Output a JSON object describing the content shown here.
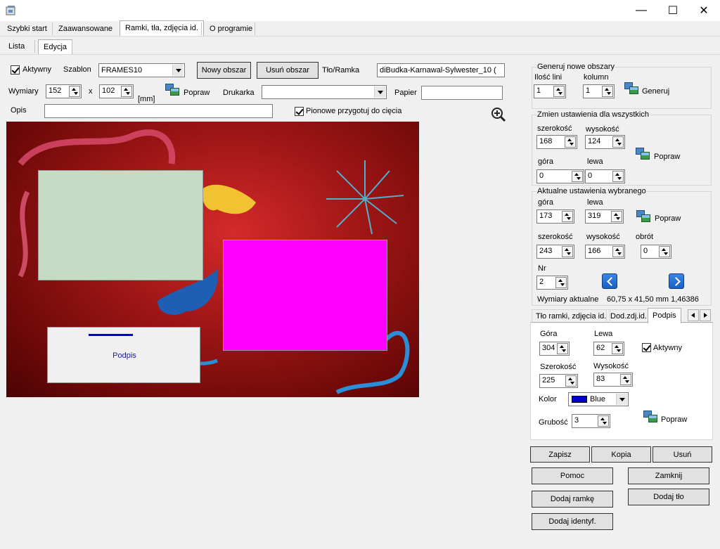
{
  "window": {
    "minimize": "—",
    "maximize": "☐",
    "close": "✕"
  },
  "main_tabs": [
    {
      "label": "Szybki start"
    },
    {
      "label": "Zaawansowane"
    },
    {
      "label": "Ramki, tła, zdjęcia id."
    },
    {
      "label": "O programie"
    }
  ],
  "sub_tabs": [
    {
      "label": "Lista"
    },
    {
      "label": "Edycja"
    }
  ],
  "toolbar": {
    "aktywny_label": "Aktywny",
    "szablon_label": "Szablon",
    "szablon_value": "FRAMES10",
    "nowy_obszar": "Nowy obszar",
    "usun_obszar": "Usuń obszar",
    "tlo_ramka_label": "Tło/Ramka",
    "tlo_ramka_value": "diBudka-Karnawal-Sylwester_10 (",
    "wymiary_label": "Wymiary",
    "width_value": "152",
    "x_label": "x",
    "height_value": "102",
    "mm_label": "[mm]",
    "popraw_label": "Popraw",
    "drukarka_label": "Drukarka",
    "drukarka_value": "",
    "papier_label": "Papier",
    "papier_value": "",
    "opis_label": "Opis",
    "opis_value": "",
    "pionowe_label": "Pionowe przygotuj do cięcia"
  },
  "canvas": {
    "podpis_label": "Podpis"
  },
  "generuj": {
    "title": "Generuj nowe obszary",
    "ilosc_lini_label": "Ilość lini",
    "ilosc_lini_value": "1",
    "kolumn_label": "kolumn",
    "kolumn_value": "1",
    "generuj_label": "Generuj"
  },
  "zmien": {
    "title": "Zmien ustawienia dla wszystkich",
    "szerokosc_label": "szerokość",
    "szerokosc_value": "168",
    "wysokosc_label": "wysokość",
    "wysokosc_value": "124",
    "popraw_label": "Popraw",
    "gora_label": "góra",
    "gora_value": "0",
    "lewa_label": "lewa",
    "lewa_value": "0"
  },
  "aktualne": {
    "title": "Aktualne ustawienia wybranego",
    "gora_label": "góra",
    "gora_value": "173",
    "lewa_label": "lewa",
    "lewa_value": "319",
    "popraw_label": "Popraw",
    "szerokosc_label": "szerokość",
    "szerokosc_value": "243",
    "wysokosc_label": "wysokość",
    "wysokosc_value": "166",
    "obrot_label": "obrót",
    "obrot_value": "0",
    "nr_label": "Nr",
    "nr_value": "2",
    "wymiary_label": "Wymiary aktualne",
    "wymiary_value": "60,75 x 41,50 mm 1,46386"
  },
  "detail_tabs": [
    {
      "label": "Tło ramki, zdjęcia id."
    },
    {
      "label": "Dod.zdj.id."
    },
    {
      "label": "Podpis"
    }
  ],
  "podpis": {
    "gora_label": "Góra",
    "gora_value": "304",
    "lewa_label": "Lewa",
    "lewa_value": "62",
    "aktywny_label": "Aktywny",
    "szerokosc_label": "Szerokość",
    "szerokosc_value": "225",
    "wysokosc_label": "Wysokość",
    "wysokosc_value": "83",
    "kolor_label": "Kolor",
    "kolor_value": "Blue",
    "kolor_hex": "#0000cc",
    "grubosc_label": "Grubość",
    "grubosc_value": "3",
    "popraw_label": "Popraw"
  },
  "actions": {
    "zapisz": "Zapisz",
    "kopia": "Kopia",
    "usun": "Usuń",
    "pomoc": "Pomoc",
    "zamknij": "Zamknij",
    "dodaj_ramke": "Dodaj ramkę",
    "dodaj_tlo": "Dodaj tło",
    "dodaj_identyf": "Dodaj identyf."
  }
}
